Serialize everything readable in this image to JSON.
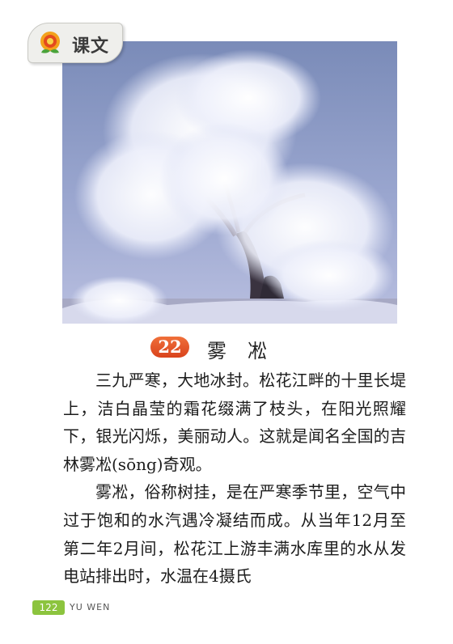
{
  "badge": {
    "label": "课文",
    "icon": "flower-sun-icon"
  },
  "photo": {
    "subject": "rime-frosted-willow-tree"
  },
  "lesson": {
    "number": "22",
    "title": "雾凇"
  },
  "paragraphs": [
    "三九严寒，大地冰封。松花江畔的十里长堤上，洁白晶莹的霜花缀满了枝头，在阳光照耀下，银光闪烁，美丽动人。这就是闻名全国的吉林雾凇(sōng)奇观。",
    "雾凇，俗称树挂，是在严寒季节里，空气中过于饱和的水汽遇冷凝结而成。从当年12月至第二年2月间，松花江上游丰满水库里的水从发电站排出时，水温在4摄氏"
  ],
  "footer": {
    "page_number": "122",
    "series": "YU WEN"
  },
  "colors": {
    "lesson_number_bg": "#e4552a",
    "page_number_bg": "#8cc43e",
    "badge_bg": "#efefec"
  }
}
